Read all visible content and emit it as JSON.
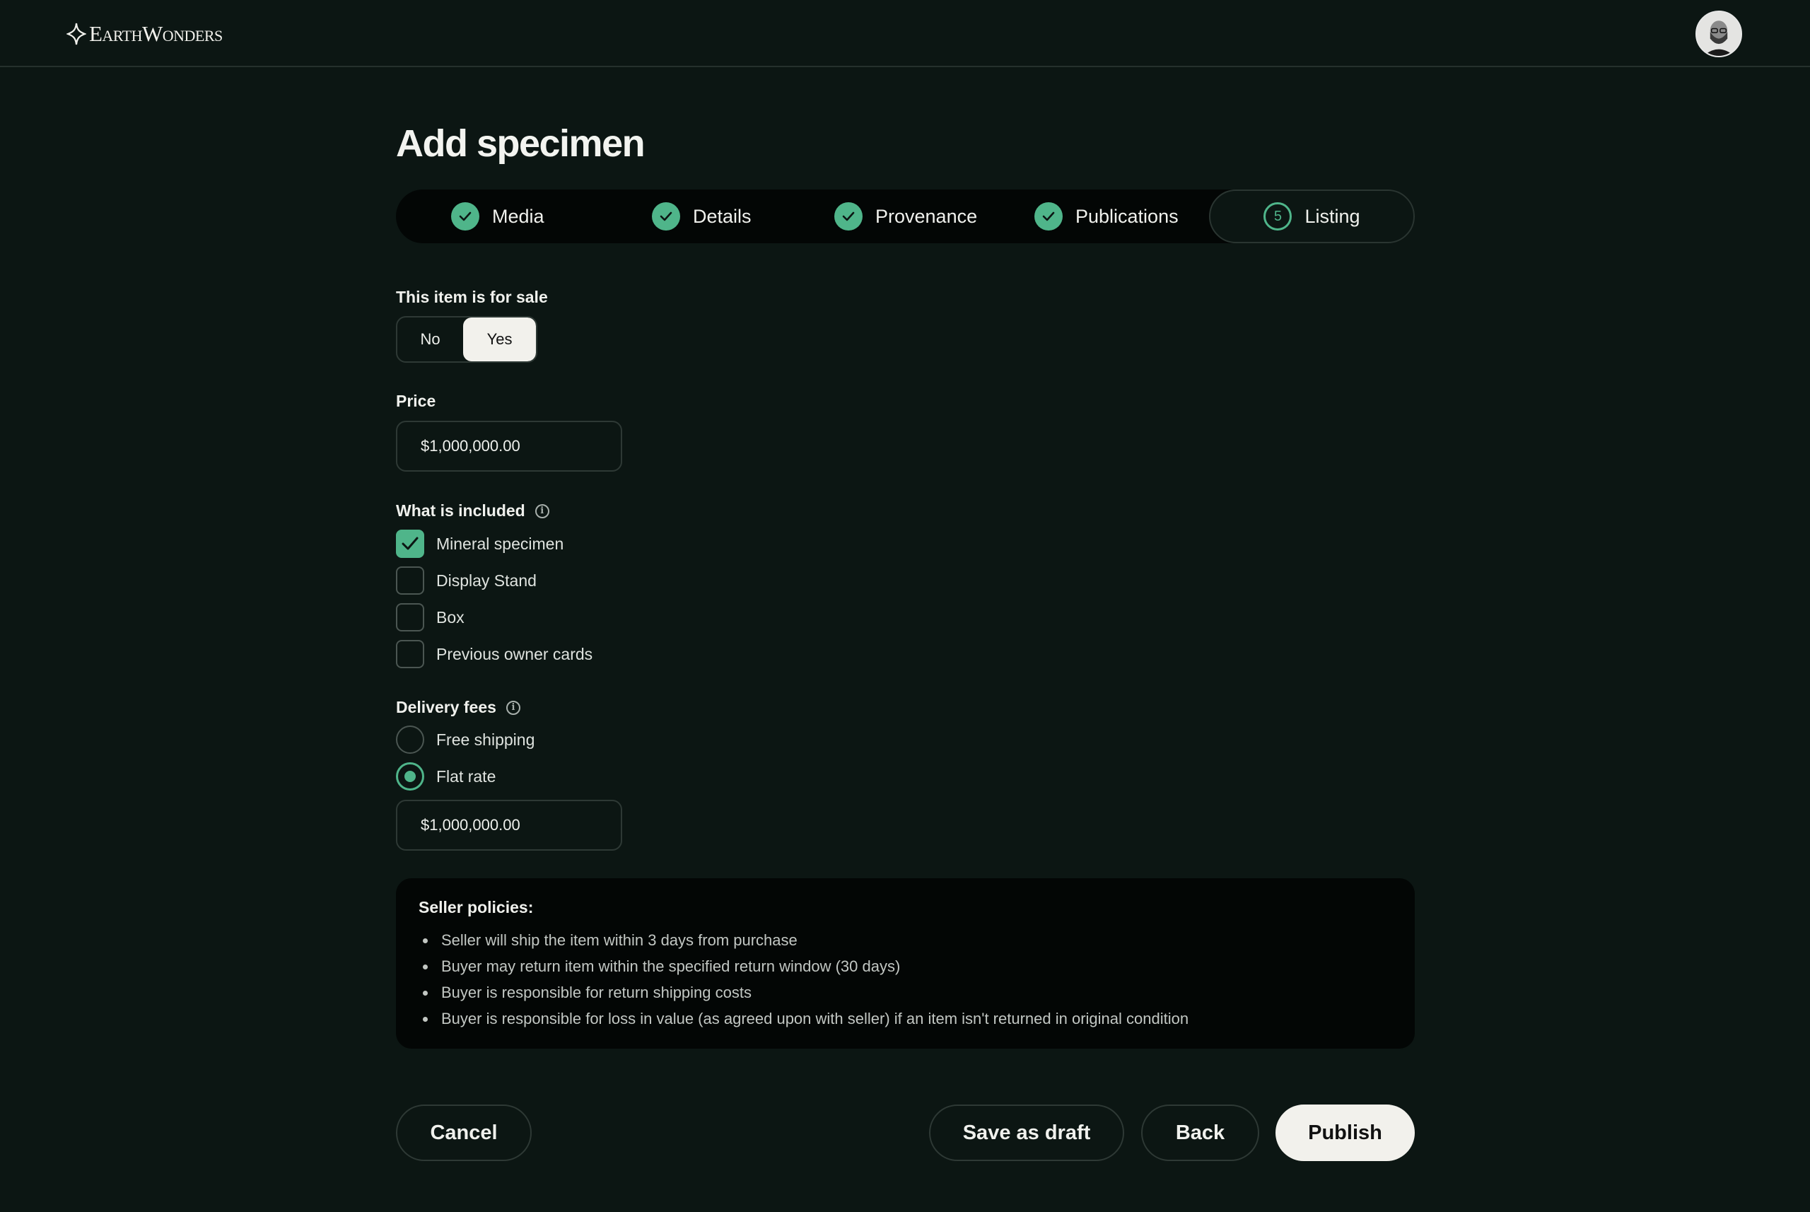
{
  "brand": {
    "logo_text": "EarthWonders"
  },
  "page": {
    "title": "Add specimen"
  },
  "steps": [
    {
      "label": "Media",
      "state": "done"
    },
    {
      "label": "Details",
      "state": "done"
    },
    {
      "label": "Provenance",
      "state": "done"
    },
    {
      "label": "Publications",
      "state": "done"
    },
    {
      "label": "Listing",
      "state": "active",
      "number": "5"
    }
  ],
  "sale": {
    "label": "This item is for sale",
    "options": [
      "No",
      "Yes"
    ],
    "selected": "Yes"
  },
  "price": {
    "label": "Price",
    "value": "$1,000,000.00"
  },
  "included": {
    "label": "What is included",
    "items": [
      {
        "label": "Mineral specimen",
        "checked": true
      },
      {
        "label": "Display Stand",
        "checked": false
      },
      {
        "label": "Box",
        "checked": false
      },
      {
        "label": "Previous owner cards",
        "checked": false
      }
    ]
  },
  "delivery": {
    "label": "Delivery fees",
    "options": [
      {
        "label": "Free shipping",
        "selected": false
      },
      {
        "label": "Flat rate",
        "selected": true
      }
    ],
    "flat_rate_value": "$1,000,000.00"
  },
  "policies": {
    "title": "Seller policies:",
    "items": [
      "Seller will ship the item within 3 days from purchase",
      "Buyer may return item within the specified return window (30 days)",
      "Buyer is responsible for return shipping costs",
      "Buyer is responsible for loss in value (as agreed upon with seller) if an item isn't returned in original condition"
    ]
  },
  "actions": {
    "cancel": "Cancel",
    "save_draft": "Save as draft",
    "back": "Back",
    "publish": "Publish"
  },
  "colors": {
    "background": "#0c1613",
    "accent": "#4fb58a",
    "panel": "#030605",
    "primary_button": "#f2f1ec"
  }
}
